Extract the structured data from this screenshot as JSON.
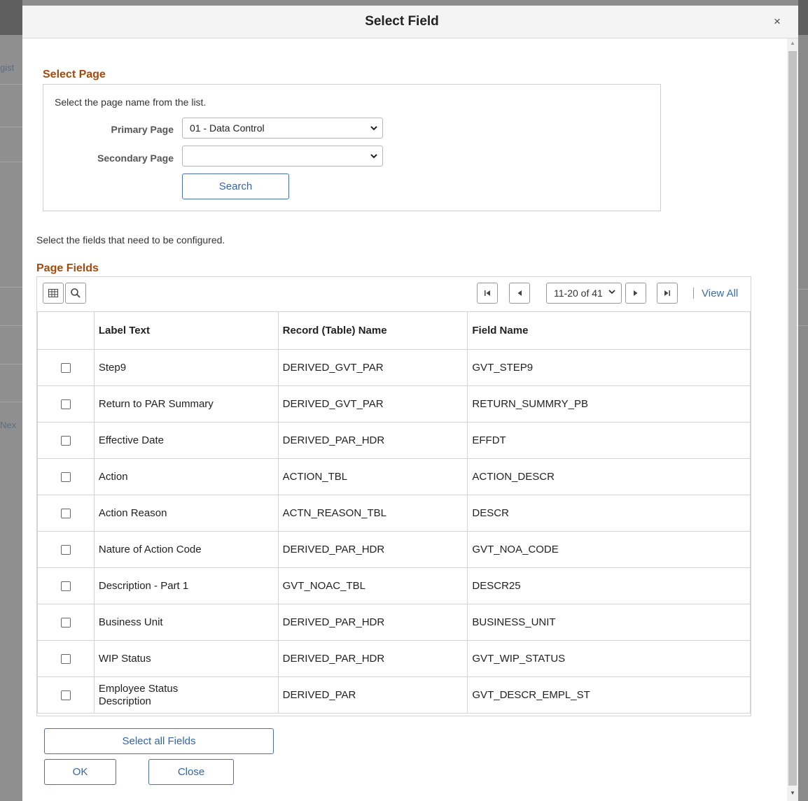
{
  "background": {
    "left_text_1": "gist",
    "left_text_2": "Nex"
  },
  "modal": {
    "title": "Select Field",
    "close_glyph": "×"
  },
  "select_page": {
    "section_title": "Select Page",
    "instruction": "Select the page name from the list.",
    "primary_label": "Primary Page",
    "primary_value": "01 - Data Control",
    "secondary_label": "Secondary Page",
    "secondary_value": "",
    "search_button": "Search"
  },
  "fields_instruction": "Select the fields that need to be configured.",
  "page_fields": {
    "section_title": "Page Fields",
    "pager": {
      "range": "11-20 of 41",
      "view_all": "View All"
    },
    "columns": [
      "Label Text",
      "Record (Table) Name",
      "Field Name"
    ],
    "rows": [
      {
        "label": "Step9",
        "record": "DERIVED_GVT_PAR",
        "field": "GVT_STEP9",
        "checked": false
      },
      {
        "label": "Return to PAR Summary",
        "record": "DERIVED_GVT_PAR",
        "field": "RETURN_SUMMRY_PB",
        "checked": false
      },
      {
        "label": "Effective Date",
        "record": "DERIVED_PAR_HDR",
        "field": "EFFDT",
        "checked": false
      },
      {
        "label": "Action",
        "record": "ACTION_TBL",
        "field": "ACTION_DESCR",
        "checked": false
      },
      {
        "label": "Action Reason",
        "record": "ACTN_REASON_TBL",
        "field": "DESCR",
        "checked": false
      },
      {
        "label": "Nature of Action Code",
        "record": "DERIVED_PAR_HDR",
        "field": "GVT_NOA_CODE",
        "checked": false
      },
      {
        "label": "Description - Part 1",
        "record": "GVT_NOAC_TBL",
        "field": "DESCR25",
        "checked": false
      },
      {
        "label": "Business Unit",
        "record": "DERIVED_PAR_HDR",
        "field": "BUSINESS_UNIT",
        "checked": false
      },
      {
        "label": "WIP Status",
        "record": "DERIVED_PAR_HDR",
        "field": "GVT_WIP_STATUS",
        "checked": false
      },
      {
        "label": "Employee Status Description",
        "record": "DERIVED_PAR",
        "field": "GVT_DESCR_EMPL_ST",
        "checked": false
      }
    ]
  },
  "buttons": {
    "select_all": "Select all Fields",
    "ok": "OK",
    "close": "Close"
  }
}
